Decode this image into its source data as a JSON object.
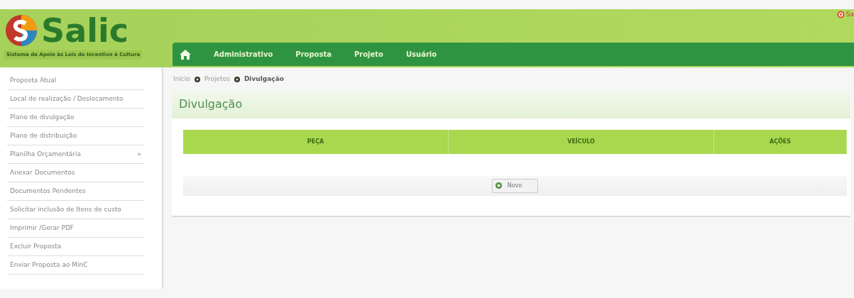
{
  "header": {
    "logo_text": "Salic",
    "tagline": "Sistema de Apoio às Leis de Incentivo à Cultura",
    "logout": "Sa"
  },
  "nav": [
    {
      "label": "Administrativo"
    },
    {
      "label": "Proposta"
    },
    {
      "label": "Projeto"
    },
    {
      "label": "Usuário"
    }
  ],
  "sidebar": {
    "items": [
      {
        "label": "Proposta Atual"
      },
      {
        "label": "Local de realização / Deslocamento"
      },
      {
        "label": "Plano de divulgação"
      },
      {
        "label": "Plano de distribuição"
      },
      {
        "label": "Planilha Orçamentária",
        "arrow": "»"
      },
      {
        "label": "Anexar Documentos"
      },
      {
        "label": "Documentos Pendentes"
      },
      {
        "label": "Solicitar inclusão de Itens de custo"
      },
      {
        "label": "Imprimir /Gerar PDF"
      },
      {
        "label": "Excluir Proposta"
      },
      {
        "label": "Enviar Proposta ao MinC"
      }
    ]
  },
  "breadcrumb": [
    "Início",
    "Projetos",
    "Divulgação"
  ],
  "page_title": "Divulgação",
  "table": {
    "columns": [
      "PEÇA",
      "VEÍCULO",
      "AÇÕES"
    ]
  },
  "buttons": [
    {
      "label": "Novo"
    }
  ]
}
